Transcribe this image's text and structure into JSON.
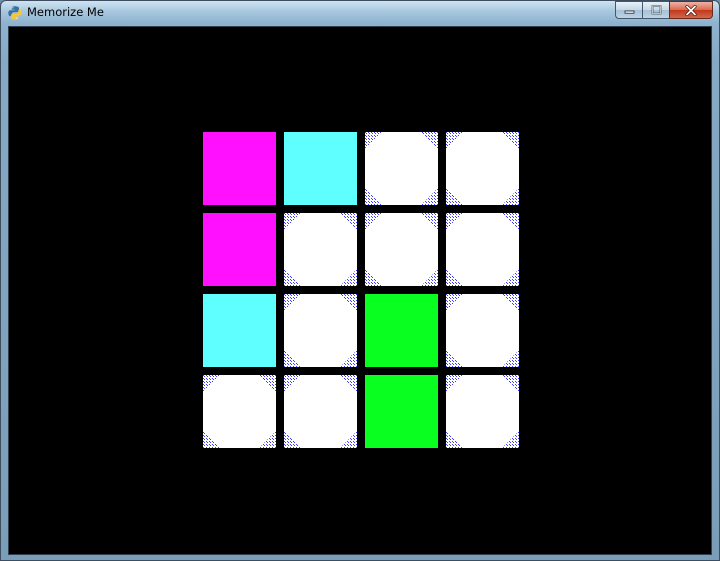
{
  "window": {
    "title": "Memorize Me",
    "icon": "python-icon",
    "controls": [
      "minimize-icon",
      "maximize-icon",
      "close-icon"
    ]
  },
  "board": {
    "rows": 4,
    "cols": 4,
    "background_color": "#000000",
    "hidden_tile_color": "#ffffff",
    "hidden_tile_corner_pattern_color": "#3d3dff",
    "cells": [
      [
        {
          "state": "revealed",
          "color": "#ff10ff"
        },
        {
          "state": "revealed",
          "color": "#60ffff"
        },
        {
          "state": "hidden"
        },
        {
          "state": "hidden"
        }
      ],
      [
        {
          "state": "revealed",
          "color": "#ff10ff"
        },
        {
          "state": "hidden"
        },
        {
          "state": "hidden"
        },
        {
          "state": "hidden"
        }
      ],
      [
        {
          "state": "revealed",
          "color": "#60ffff"
        },
        {
          "state": "hidden"
        },
        {
          "state": "revealed",
          "color": "#08ff20"
        },
        {
          "state": "hidden"
        }
      ],
      [
        {
          "state": "hidden"
        },
        {
          "state": "hidden"
        },
        {
          "state": "revealed",
          "color": "#08ff20"
        },
        {
          "state": "hidden"
        }
      ]
    ]
  }
}
